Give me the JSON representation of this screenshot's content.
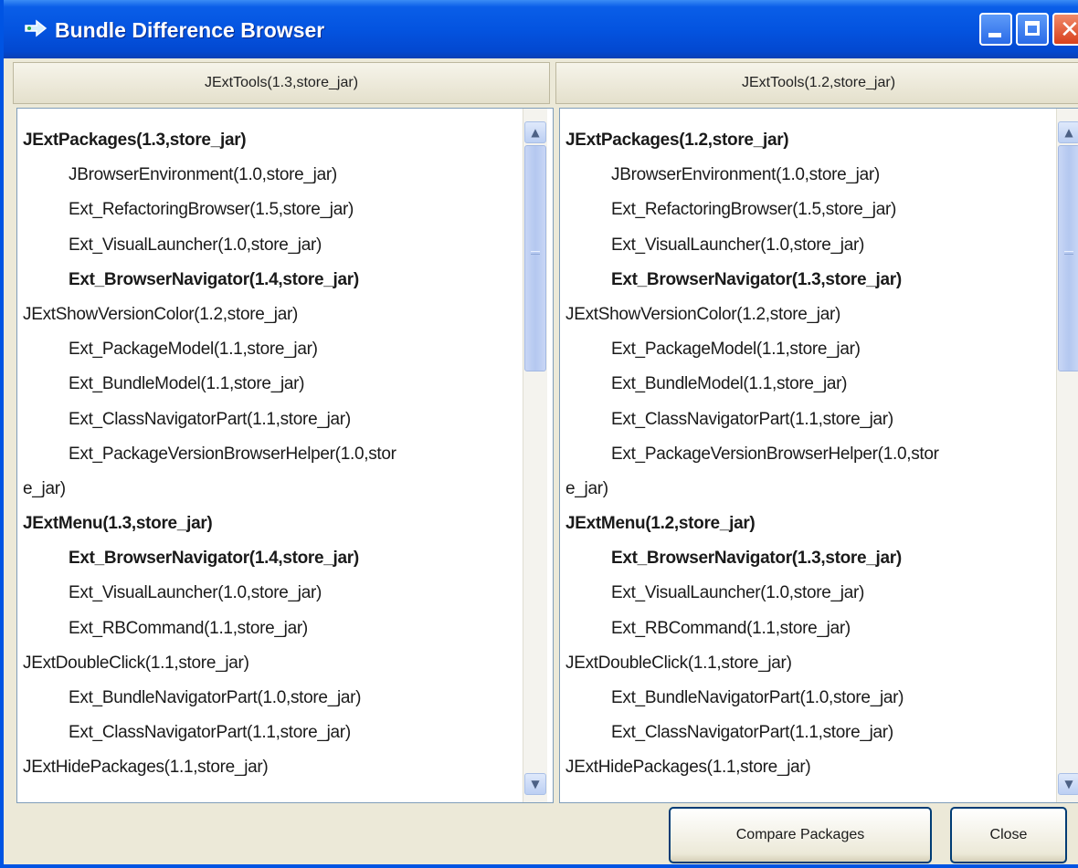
{
  "window": {
    "title": "Bundle Difference Browser",
    "icon": "bundle-diff-icon",
    "accent_color": "#0054e3"
  },
  "left_panel": {
    "header": "JExtTools(1.3,store_jar)",
    "lines": [
      {
        "text": "JExtPackages(1.3,store_jar)",
        "indent": 0,
        "bold": true
      },
      {
        "text": "JBrowserEnvironment(1.0,store_jar)",
        "indent": 1,
        "bold": false
      },
      {
        "text": "Ext_RefactoringBrowser(1.5,store_jar)",
        "indent": 1,
        "bold": false
      },
      {
        "text": "Ext_VisualLauncher(1.0,store_jar)",
        "indent": 1,
        "bold": false
      },
      {
        "text": "Ext_BrowserNavigator(1.4,store_jar)",
        "indent": 1,
        "bold": true
      },
      {
        "text": "JExtShowVersionColor(1.2,store_jar)",
        "indent": 0,
        "bold": false
      },
      {
        "text": "Ext_PackageModel(1.1,store_jar)",
        "indent": 1,
        "bold": false
      },
      {
        "text": "Ext_BundleModel(1.1,store_jar)",
        "indent": 1,
        "bold": false
      },
      {
        "text": "Ext_ClassNavigatorPart(1.1,store_jar)",
        "indent": 1,
        "bold": false
      },
      {
        "text": "Ext_PackageVersionBrowserHelper(1.0,stor",
        "indent": 1,
        "bold": false
      },
      {
        "text": "e_jar)",
        "indent": 0,
        "bold": false
      },
      {
        "text": "JExtMenu(1.3,store_jar)",
        "indent": 0,
        "bold": true
      },
      {
        "text": "Ext_BrowserNavigator(1.4,store_jar)",
        "indent": 1,
        "bold": true
      },
      {
        "text": "Ext_VisualLauncher(1.0,store_jar)",
        "indent": 1,
        "bold": false
      },
      {
        "text": "Ext_RBCommand(1.1,store_jar)",
        "indent": 1,
        "bold": false
      },
      {
        "text": "JExtDoubleClick(1.1,store_jar)",
        "indent": 0,
        "bold": false
      },
      {
        "text": "Ext_BundleNavigatorPart(1.0,store_jar)",
        "indent": 1,
        "bold": false
      },
      {
        "text": "Ext_ClassNavigatorPart(1.1,store_jar)",
        "indent": 1,
        "bold": false
      },
      {
        "text": "JExtHidePackages(1.1,store_jar)",
        "indent": 0,
        "bold": false
      }
    ]
  },
  "right_panel": {
    "header": "JExtTools(1.2,store_jar)",
    "lines": [
      {
        "text": "JExtPackages(1.2,store_jar)",
        "indent": 0,
        "bold": true
      },
      {
        "text": "JBrowserEnvironment(1.0,store_jar)",
        "indent": 1,
        "bold": false
      },
      {
        "text": "Ext_RefactoringBrowser(1.5,store_jar)",
        "indent": 1,
        "bold": false
      },
      {
        "text": "Ext_VisualLauncher(1.0,store_jar)",
        "indent": 1,
        "bold": false
      },
      {
        "text": "Ext_BrowserNavigator(1.3,store_jar)",
        "indent": 1,
        "bold": true
      },
      {
        "text": "JExtShowVersionColor(1.2,store_jar)",
        "indent": 0,
        "bold": false
      },
      {
        "text": "Ext_PackageModel(1.1,store_jar)",
        "indent": 1,
        "bold": false
      },
      {
        "text": "Ext_BundleModel(1.1,store_jar)",
        "indent": 1,
        "bold": false
      },
      {
        "text": "Ext_ClassNavigatorPart(1.1,store_jar)",
        "indent": 1,
        "bold": false
      },
      {
        "text": "Ext_PackageVersionBrowserHelper(1.0,stor",
        "indent": 1,
        "bold": false
      },
      {
        "text": "e_jar)",
        "indent": 0,
        "bold": false
      },
      {
        "text": "JExtMenu(1.2,store_jar)",
        "indent": 0,
        "bold": true
      },
      {
        "text": "Ext_BrowserNavigator(1.3,store_jar)",
        "indent": 1,
        "bold": true
      },
      {
        "text": "Ext_VisualLauncher(1.0,store_jar)",
        "indent": 1,
        "bold": false
      },
      {
        "text": "Ext_RBCommand(1.1,store_jar)",
        "indent": 1,
        "bold": false
      },
      {
        "text": "JExtDoubleClick(1.1,store_jar)",
        "indent": 0,
        "bold": false
      },
      {
        "text": "Ext_BundleNavigatorPart(1.0,store_jar)",
        "indent": 1,
        "bold": false
      },
      {
        "text": "Ext_ClassNavigatorPart(1.1,store_jar)",
        "indent": 1,
        "bold": false
      },
      {
        "text": "JExtHidePackages(1.1,store_jar)",
        "indent": 0,
        "bold": false
      }
    ]
  },
  "buttons": {
    "compare": "Compare Packages",
    "close": "Close"
  }
}
